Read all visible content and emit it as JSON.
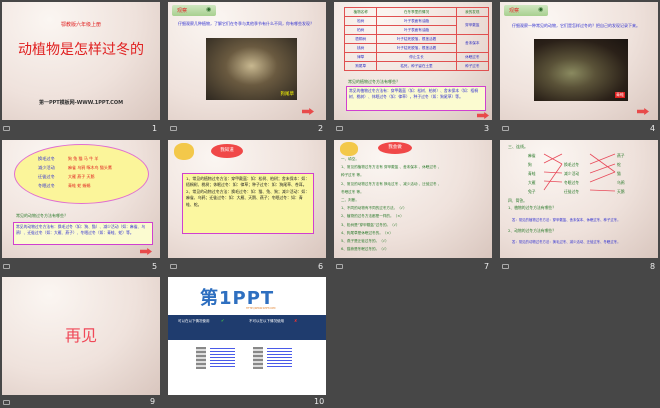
{
  "slides": [
    {
      "number": "1",
      "publisher": "鄂教版六年级上册",
      "title": "动植物是怎样过冬的",
      "footer": "第一PPT模板网-WWW.1PPT.COM"
    },
    {
      "number": "2",
      "tag": "观察",
      "text": "仔细观察几种植物，了解它们在冬季与其他季节有什么不同，你有哪些发现？",
      "photo_label": "狗尾草"
    },
    {
      "number": "3",
      "table_headers": [
        "植物名称",
        "在冬季里的情况",
        "我的发现"
      ],
      "table_rows": [
        [
          "松树",
          "叶子表面有油脂"
        ],
        [
          "柏树",
          "叶子表面有油脂"
        ],
        [
          "梧桐树",
          "叶子枯死脱落，根茎活着"
        ],
        [
          "桃树",
          "叶子枯死脱落，根茎活着"
        ],
        [
          "律草",
          "停止生长"
        ],
        [
          "狗尾草",
          "枯死，种子留在土里"
        ]
      ],
      "findings": [
        "穿甲戴盔",
        "舍末保本",
        "休眠过冬",
        "种子过冬"
      ],
      "question": "常见的植物过冬方法有哪些？",
      "answer": "常见的植物过冬方法有：穿甲戴盔（如：松树、柏树）、舍末保本（如：梧桐树、桃树）、休眠过冬（如：律草），种子过冬（如：狗尾草）等。"
    },
    {
      "number": "4",
      "tag": "观察",
      "text": "仔细观察一种常见的动物，它们是怎样过冬的？把自己的发现记录下来。",
      "photo_label": "青蛙"
    },
    {
      "number": "5",
      "groups": [
        [
          "换毛过冬",
          "狗  兔  猫  马  牛  羊"
        ],
        [
          "减少活动",
          "麻雀  乌鸦  啄木鸟  猫头鹰"
        ],
        [
          "迁徙过冬",
          "大雁  燕子  天鹅"
        ],
        [
          "冬眠过冬",
          "青蛙  蛇  蜥蜴"
        ]
      ],
      "question": "常见的动物过冬方法有哪些？",
      "answer": "常见的动物过冬方法有：换毛过冬（如：狗、猫）、减少活动（如：麻雀、乌鸦）、迁徙过冬（如：大雁、燕子）、冬眠过冬（如：青蛙、蛇）等。"
    },
    {
      "number": "6",
      "badge": "我知道",
      "p1": "1、常见的植物过冬方法：穿甲戴盔：如：松树、柏树；舍末保本：如：梧桐树、桃树；休眠过冬：如：律草；种子过冬：如：狗尾草、苍耳。",
      "p2": "2、常见的动物过冬方法：换毛过冬：如：猫、兔、狗；减少活动：如：麻雀、乌鸦；迁徙过冬：如：大雁、天鹅、燕子；冬眠过冬：如：青蛙、蛇。"
    },
    {
      "number": "7",
      "badge": "我会做",
      "lines": [
        "一、填空。",
        "1、常见的植物过冬方法有 穿甲戴盔 、舍末保本 、休眠过冬 、",
        "种子过冬 等。",
        "2、常见的动物过冬方法有 换毛过冬 、减少活动 、迁徙过冬 、",
        "冬眠过冬 等。",
        "二、判断。",
        "1、不同的动物有不同的过冬方法。（√）",
        "2、植物的过冬方法都是一样的。（×）",
        "3、松树是“穿甲戴盔”过冬的。（√）",
        "4、狗尾草是休眠过冬的。（×）",
        "5、燕子是迁徙过冬的。（√）",
        "6、猫熊是冬眠过冬的。（√）"
      ]
    },
    {
      "number": "8",
      "heading3": "三、连线。",
      "left": [
        "麻雀",
        "狗",
        "青蛙",
        "大雁",
        "兔子"
      ],
      "middle": [
        "换毛过冬",
        "减少活动",
        "冬眠过冬",
        "迁徙过冬"
      ],
      "right": [
        "燕子",
        "蛇",
        "猫",
        "乌鸦",
        "天鹅"
      ],
      "heading4": "四、简答。",
      "q1": "1、植物的过冬方法有哪些？",
      "a1": "答：常见的植物过冬方法：穿甲戴盔、舍末保本、休眠过冬、种子过冬。",
      "q2": "2、动物的过冬方法有哪些？",
      "a2": "答：常见的动物过冬方法：换毛过冬、减少活动、迁徙过冬、冬眠过冬。"
    },
    {
      "number": "9",
      "text": "再见"
    },
    {
      "number": "10",
      "logo": "第1PPT",
      "url": "HTTP://WWW.1PPT.COM",
      "can": "可以在以下情况使用",
      "cannot": "不可以在以下情况使用"
    }
  ]
}
